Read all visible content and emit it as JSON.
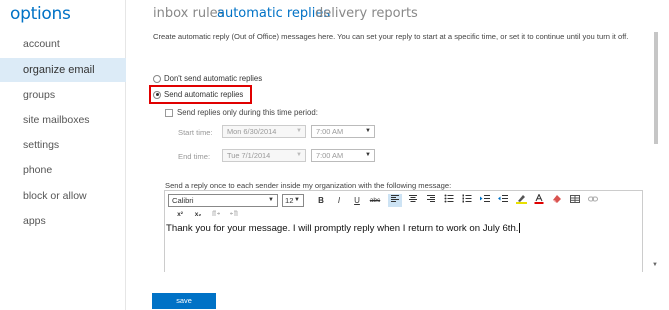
{
  "sidebar": {
    "title": "options",
    "items": [
      {
        "label": "account"
      },
      {
        "label": "organize email"
      },
      {
        "label": "groups"
      },
      {
        "label": "site mailboxes"
      },
      {
        "label": "settings"
      },
      {
        "label": "phone"
      },
      {
        "label": "block or allow"
      },
      {
        "label": "apps"
      }
    ],
    "active_item": "organize email"
  },
  "tabs": [
    {
      "label": "inbox rules"
    },
    {
      "label": "automatic replies"
    },
    {
      "label": "delivery reports"
    }
  ],
  "active_tab": "automatic replies",
  "description": "Create automatic reply (Out of Office) messages here. You can set your reply to start at a specific time, or set it to continue until you turn it off.",
  "options": {
    "dont_send_label": "Don't send automatic replies",
    "send_label": "Send automatic replies",
    "selected": "Send automatic replies",
    "time_period_label": "Send replies only during this time period:",
    "time_period_checked": false
  },
  "schedule": {
    "start_label": "Start time:",
    "start_date": "Mon 6/30/2014",
    "start_time": "7:00 AM",
    "end_label": "End time:",
    "end_date": "Tue 7/1/2014",
    "end_time": "7:00 AM"
  },
  "reply_label": "Send a reply once to each sender inside my organization with the following message:",
  "editor": {
    "font": "Calibri",
    "size": "12",
    "message": "Thank you for your message. I will promptly reply when I return to work on July 6th."
  },
  "toolbar_glyphs": {
    "bold": "B",
    "italic": "I",
    "underline": "U",
    "strike": "abc",
    "superscript": "x²",
    "subscript": "x₂"
  },
  "save_label": "save",
  "colors": {
    "accent": "#0072c6",
    "highlight_border": "#e00000",
    "active_nav_bg": "#dcebf7"
  }
}
